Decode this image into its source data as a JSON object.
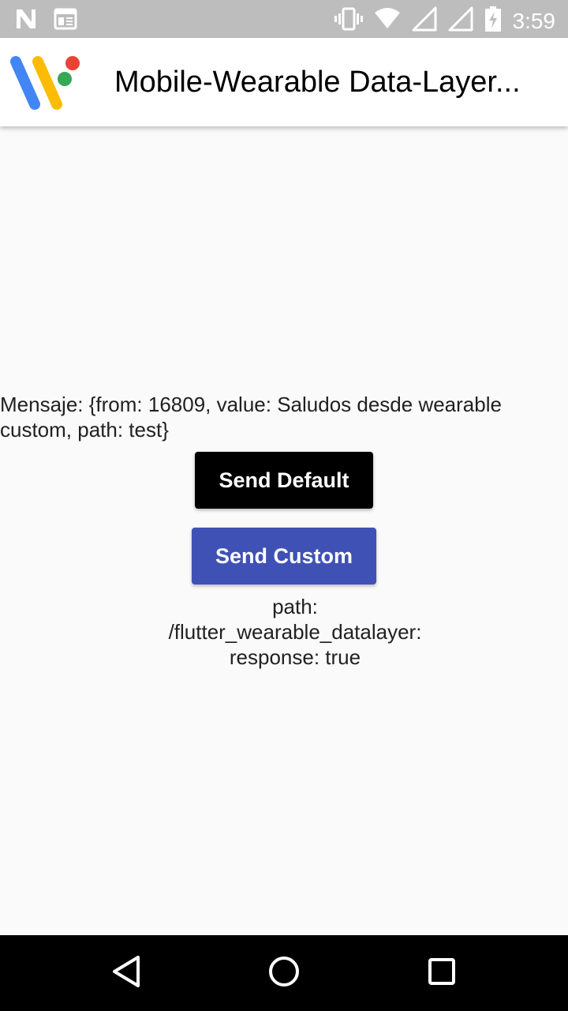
{
  "status_bar": {
    "time": "3:59",
    "left_icons": [
      "n-icon",
      "calendar-news-icon"
    ],
    "right_icons": [
      "vibrate-icon",
      "wifi-icon",
      "signal-icon",
      "signal-icon-2",
      "battery-charging-icon"
    ]
  },
  "app_bar": {
    "title": "Mobile-Wearable Data-Layer...",
    "logo": "wear-os-logo",
    "logo_colors": {
      "blue": "#4285f4",
      "yellow": "#fbbc05",
      "green": "#34a853",
      "red": "#ea4335"
    }
  },
  "main": {
    "message": "Mensaje: {from: 16809, value: Saludos desde wearable custom, path: test}",
    "send_default_label": "Send Default",
    "send_custom_label": "Send Custom",
    "response_lines": [
      "path:",
      "/flutter_wearable_datalayer:",
      "response: true"
    ]
  },
  "colors": {
    "accent": "#3f51b5",
    "default_button": "#000000",
    "background": "#fafafa",
    "status_bar": "#bdbdbd"
  },
  "nav_bar": {
    "buttons": [
      "back-icon",
      "home-icon",
      "recents-icon"
    ]
  }
}
